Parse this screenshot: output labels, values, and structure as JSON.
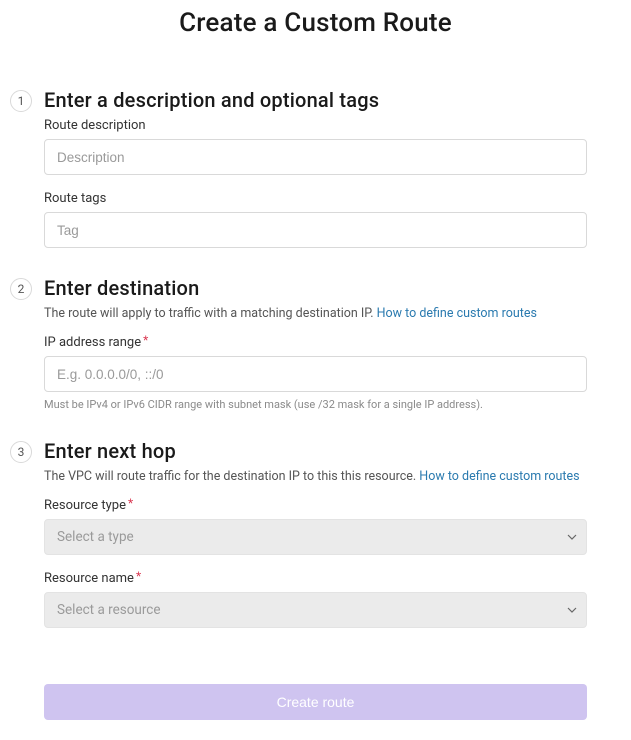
{
  "title": "Create a Custom Route",
  "steps": {
    "s1": {
      "num": "1",
      "title": "Enter a description and optional tags",
      "desc_label": "Route description",
      "desc_placeholder": "Description",
      "tags_label": "Route tags",
      "tags_placeholder": "Tag"
    },
    "s2": {
      "num": "2",
      "title": "Enter destination",
      "desc_prefix": "The route will apply to traffic with a matching destination IP. ",
      "help_text": "How to define custom routes",
      "ip_label": "IP address range",
      "ip_placeholder": "E.g. 0.0.0.0/0, ::/0",
      "ip_helper": "Must be IPv4 or IPv6 CIDR range with subnet mask (use /32 mask for a single IP address)."
    },
    "s3": {
      "num": "3",
      "title": "Enter next hop",
      "desc_prefix": "The VPC will route traffic for the destination IP to this this resource. ",
      "help_text": "How to define custom routes",
      "type_label": "Resource type",
      "type_placeholder": "Select a type",
      "name_label": "Resource name",
      "name_placeholder": "Select a resource"
    }
  },
  "actions": {
    "create_label": "Create route"
  }
}
